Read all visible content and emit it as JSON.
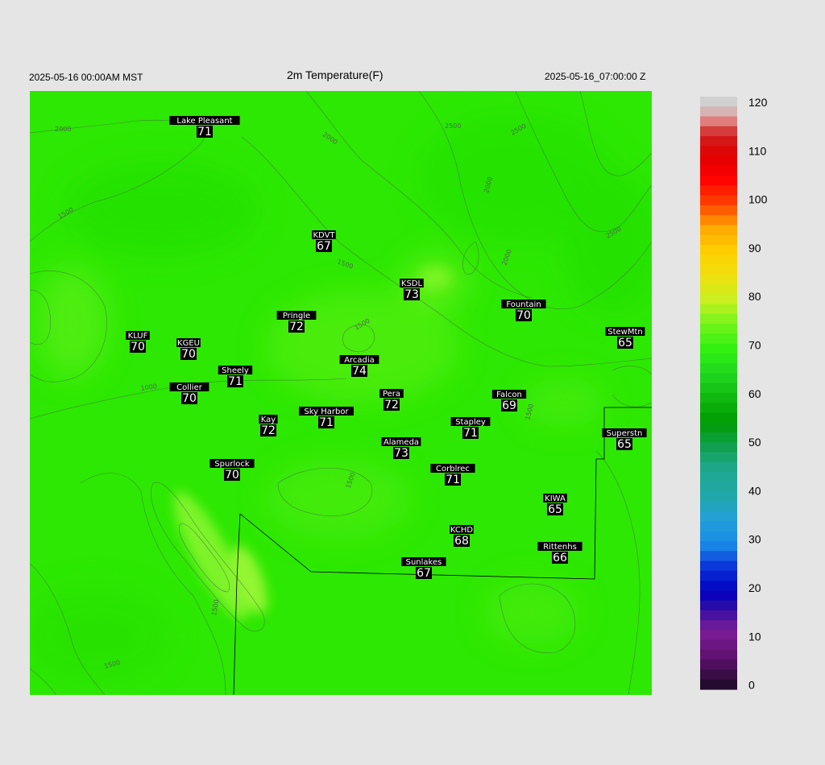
{
  "header": {
    "local_time": "2025-05-16 00:00AM MST",
    "title": "2m Temperature(F)",
    "utc_time": "2025-05-16_07:00:00 Z"
  },
  "colorbar": {
    "ticks": [
      "120",
      "110",
      "100",
      "90",
      "80",
      "70",
      "60",
      "50",
      "40",
      "30",
      "20",
      "10",
      "0"
    ]
  },
  "contour_labels": [
    "2000",
    "1500",
    "1000",
    "2500",
    "2000",
    "2500",
    "2000",
    "1500",
    "1500",
    "1500",
    "1500",
    "2000",
    "1500",
    "2500",
    "1500"
  ],
  "stations": [
    {
      "name": "Lake Pleasant",
      "value": "71"
    },
    {
      "name": "KDVT",
      "value": "67"
    },
    {
      "name": "KSDL",
      "value": "73"
    },
    {
      "name": "Fountain",
      "value": "70"
    },
    {
      "name": "Pringle",
      "value": "72"
    },
    {
      "name": "KLUF",
      "value": "70"
    },
    {
      "name": "KGEU",
      "value": "70"
    },
    {
      "name": "StewMtn",
      "value": "65"
    },
    {
      "name": "Arcadia",
      "value": "74"
    },
    {
      "name": "Sheely",
      "value": "71"
    },
    {
      "name": "Collier",
      "value": "70"
    },
    {
      "name": "Pera",
      "value": "72"
    },
    {
      "name": "Falcon",
      "value": "69"
    },
    {
      "name": "Kay",
      "value": "72"
    },
    {
      "name": "Sky Harbor",
      "value": "71"
    },
    {
      "name": "Stapley",
      "value": "71"
    },
    {
      "name": "Superstn",
      "value": "65"
    },
    {
      "name": "Alameda",
      "value": "73"
    },
    {
      "name": "Spurlock",
      "value": "70"
    },
    {
      "name": "Corblrec",
      "value": "71"
    },
    {
      "name": "KIWA",
      "value": "65"
    },
    {
      "name": "KCHD",
      "value": "68"
    },
    {
      "name": "Rittenhs",
      "value": "66"
    },
    {
      "name": "Sunlakes",
      "value": "67"
    }
  ]
}
